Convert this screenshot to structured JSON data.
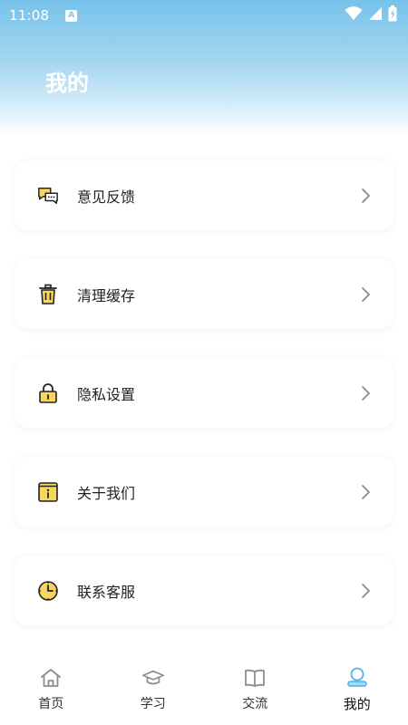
{
  "status_bar": {
    "time": "11:08",
    "notification_badge": "A",
    "icons": [
      "wifi-icon",
      "cellular-signal-icon",
      "battery-icon"
    ]
  },
  "header": {
    "title": "我的"
  },
  "menu": {
    "items": [
      {
        "label": "意见反馈",
        "icon": "feedback-chat-icon"
      },
      {
        "label": "清理缓存",
        "icon": "trash-icon"
      },
      {
        "label": "隐私设置",
        "icon": "lock-icon"
      },
      {
        "label": "关于我们",
        "icon": "info-icon"
      },
      {
        "label": "联系客服",
        "icon": "clock-icon"
      }
    ],
    "chevron_icon": "chevron-right-icon"
  },
  "tab_bar": {
    "tabs": [
      {
        "label": "首页",
        "icon": "home-icon",
        "active": false
      },
      {
        "label": "学习",
        "icon": "graduation-cap-icon",
        "active": false
      },
      {
        "label": "交流",
        "icon": "book-icon",
        "active": false
      },
      {
        "label": "我的",
        "icon": "user-icon",
        "active": true
      }
    ]
  },
  "colors": {
    "header_gradient_top": "#76c2ea",
    "icon_yellow": "#f7d65c",
    "icon_outline": "#222222",
    "active_tab_blue": "#4fb1e6",
    "inactive_tab_gray": "#8c8c8c",
    "chevron_gray": "#8a8a8a"
  }
}
